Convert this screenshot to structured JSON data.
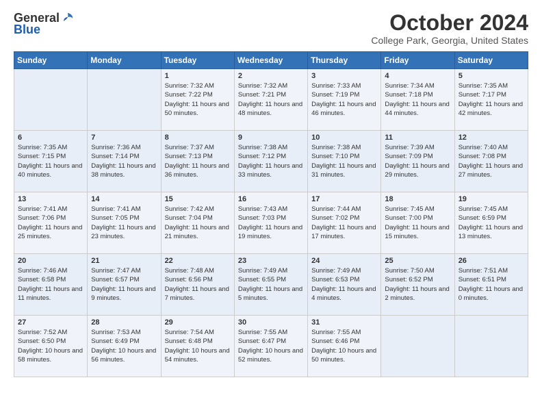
{
  "header": {
    "logo_general": "General",
    "logo_blue": "Blue",
    "title": "October 2024",
    "location": "College Park, Georgia, United States"
  },
  "weekdays": [
    "Sunday",
    "Monday",
    "Tuesday",
    "Wednesday",
    "Thursday",
    "Friday",
    "Saturday"
  ],
  "weeks": [
    [
      {
        "day": "",
        "sunrise": "",
        "sunset": "",
        "daylight": ""
      },
      {
        "day": "",
        "sunrise": "",
        "sunset": "",
        "daylight": ""
      },
      {
        "day": "1",
        "sunrise": "Sunrise: 7:32 AM",
        "sunset": "Sunset: 7:22 PM",
        "daylight": "Daylight: 11 hours and 50 minutes."
      },
      {
        "day": "2",
        "sunrise": "Sunrise: 7:32 AM",
        "sunset": "Sunset: 7:21 PM",
        "daylight": "Daylight: 11 hours and 48 minutes."
      },
      {
        "day": "3",
        "sunrise": "Sunrise: 7:33 AM",
        "sunset": "Sunset: 7:19 PM",
        "daylight": "Daylight: 11 hours and 46 minutes."
      },
      {
        "day": "4",
        "sunrise": "Sunrise: 7:34 AM",
        "sunset": "Sunset: 7:18 PM",
        "daylight": "Daylight: 11 hours and 44 minutes."
      },
      {
        "day": "5",
        "sunrise": "Sunrise: 7:35 AM",
        "sunset": "Sunset: 7:17 PM",
        "daylight": "Daylight: 11 hours and 42 minutes."
      }
    ],
    [
      {
        "day": "6",
        "sunrise": "Sunrise: 7:35 AM",
        "sunset": "Sunset: 7:15 PM",
        "daylight": "Daylight: 11 hours and 40 minutes."
      },
      {
        "day": "7",
        "sunrise": "Sunrise: 7:36 AM",
        "sunset": "Sunset: 7:14 PM",
        "daylight": "Daylight: 11 hours and 38 minutes."
      },
      {
        "day": "8",
        "sunrise": "Sunrise: 7:37 AM",
        "sunset": "Sunset: 7:13 PM",
        "daylight": "Daylight: 11 hours and 36 minutes."
      },
      {
        "day": "9",
        "sunrise": "Sunrise: 7:38 AM",
        "sunset": "Sunset: 7:12 PM",
        "daylight": "Daylight: 11 hours and 33 minutes."
      },
      {
        "day": "10",
        "sunrise": "Sunrise: 7:38 AM",
        "sunset": "Sunset: 7:10 PM",
        "daylight": "Daylight: 11 hours and 31 minutes."
      },
      {
        "day": "11",
        "sunrise": "Sunrise: 7:39 AM",
        "sunset": "Sunset: 7:09 PM",
        "daylight": "Daylight: 11 hours and 29 minutes."
      },
      {
        "day": "12",
        "sunrise": "Sunrise: 7:40 AM",
        "sunset": "Sunset: 7:08 PM",
        "daylight": "Daylight: 11 hours and 27 minutes."
      }
    ],
    [
      {
        "day": "13",
        "sunrise": "Sunrise: 7:41 AM",
        "sunset": "Sunset: 7:06 PM",
        "daylight": "Daylight: 11 hours and 25 minutes."
      },
      {
        "day": "14",
        "sunrise": "Sunrise: 7:41 AM",
        "sunset": "Sunset: 7:05 PM",
        "daylight": "Daylight: 11 hours and 23 minutes."
      },
      {
        "day": "15",
        "sunrise": "Sunrise: 7:42 AM",
        "sunset": "Sunset: 7:04 PM",
        "daylight": "Daylight: 11 hours and 21 minutes."
      },
      {
        "day": "16",
        "sunrise": "Sunrise: 7:43 AM",
        "sunset": "Sunset: 7:03 PM",
        "daylight": "Daylight: 11 hours and 19 minutes."
      },
      {
        "day": "17",
        "sunrise": "Sunrise: 7:44 AM",
        "sunset": "Sunset: 7:02 PM",
        "daylight": "Daylight: 11 hours and 17 minutes."
      },
      {
        "day": "18",
        "sunrise": "Sunrise: 7:45 AM",
        "sunset": "Sunset: 7:00 PM",
        "daylight": "Daylight: 11 hours and 15 minutes."
      },
      {
        "day": "19",
        "sunrise": "Sunrise: 7:45 AM",
        "sunset": "Sunset: 6:59 PM",
        "daylight": "Daylight: 11 hours and 13 minutes."
      }
    ],
    [
      {
        "day": "20",
        "sunrise": "Sunrise: 7:46 AM",
        "sunset": "Sunset: 6:58 PM",
        "daylight": "Daylight: 11 hours and 11 minutes."
      },
      {
        "day": "21",
        "sunrise": "Sunrise: 7:47 AM",
        "sunset": "Sunset: 6:57 PM",
        "daylight": "Daylight: 11 hours and 9 minutes."
      },
      {
        "day": "22",
        "sunrise": "Sunrise: 7:48 AM",
        "sunset": "Sunset: 6:56 PM",
        "daylight": "Daylight: 11 hours and 7 minutes."
      },
      {
        "day": "23",
        "sunrise": "Sunrise: 7:49 AM",
        "sunset": "Sunset: 6:55 PM",
        "daylight": "Daylight: 11 hours and 5 minutes."
      },
      {
        "day": "24",
        "sunrise": "Sunrise: 7:49 AM",
        "sunset": "Sunset: 6:53 PM",
        "daylight": "Daylight: 11 hours and 4 minutes."
      },
      {
        "day": "25",
        "sunrise": "Sunrise: 7:50 AM",
        "sunset": "Sunset: 6:52 PM",
        "daylight": "Daylight: 11 hours and 2 minutes."
      },
      {
        "day": "26",
        "sunrise": "Sunrise: 7:51 AM",
        "sunset": "Sunset: 6:51 PM",
        "daylight": "Daylight: 11 hours and 0 minutes."
      }
    ],
    [
      {
        "day": "27",
        "sunrise": "Sunrise: 7:52 AM",
        "sunset": "Sunset: 6:50 PM",
        "daylight": "Daylight: 10 hours and 58 minutes."
      },
      {
        "day": "28",
        "sunrise": "Sunrise: 7:53 AM",
        "sunset": "Sunset: 6:49 PM",
        "daylight": "Daylight: 10 hours and 56 minutes."
      },
      {
        "day": "29",
        "sunrise": "Sunrise: 7:54 AM",
        "sunset": "Sunset: 6:48 PM",
        "daylight": "Daylight: 10 hours and 54 minutes."
      },
      {
        "day": "30",
        "sunrise": "Sunrise: 7:55 AM",
        "sunset": "Sunset: 6:47 PM",
        "daylight": "Daylight: 10 hours and 52 minutes."
      },
      {
        "day": "31",
        "sunrise": "Sunrise: 7:55 AM",
        "sunset": "Sunset: 6:46 PM",
        "daylight": "Daylight: 10 hours and 50 minutes."
      },
      {
        "day": "",
        "sunrise": "",
        "sunset": "",
        "daylight": ""
      },
      {
        "day": "",
        "sunrise": "",
        "sunset": "",
        "daylight": ""
      }
    ]
  ]
}
